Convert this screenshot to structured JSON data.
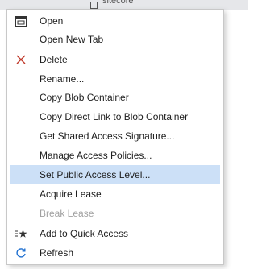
{
  "background": {
    "title": "sitecore"
  },
  "menu": {
    "items": [
      {
        "label": "Open",
        "icon": "window-icon",
        "highlighted": false,
        "disabled": false
      },
      {
        "label": "Open New Tab",
        "icon": null,
        "highlighted": false,
        "disabled": false
      },
      {
        "label": "Delete",
        "icon": "delete-x-icon",
        "highlighted": false,
        "disabled": false
      },
      {
        "label": "Rename...",
        "icon": null,
        "highlighted": false,
        "disabled": false
      },
      {
        "label": "Copy Blob Container",
        "icon": null,
        "highlighted": false,
        "disabled": false
      },
      {
        "label": "Copy Direct Link to Blob Container",
        "icon": null,
        "highlighted": false,
        "disabled": false
      },
      {
        "label": "Get Shared Access Signature...",
        "icon": null,
        "highlighted": false,
        "disabled": false
      },
      {
        "label": "Manage Access Policies...",
        "icon": null,
        "highlighted": false,
        "disabled": false
      },
      {
        "label": "Set Public Access Level...",
        "icon": null,
        "highlighted": true,
        "disabled": false
      },
      {
        "label": "Acquire Lease",
        "icon": null,
        "highlighted": false,
        "disabled": false
      },
      {
        "label": "Break Lease",
        "icon": null,
        "highlighted": false,
        "disabled": true
      },
      {
        "label": "Add to Quick Access",
        "icon": "quick-access-star-icon",
        "highlighted": false,
        "disabled": false
      },
      {
        "label": "Refresh",
        "icon": "refresh-icon",
        "highlighted": false,
        "disabled": false
      }
    ]
  },
  "colors": {
    "highlight": "#cce0f7",
    "delete": "#c0392b",
    "refresh": "#1e6fd0",
    "disabled_text": "#a0a0a0"
  }
}
